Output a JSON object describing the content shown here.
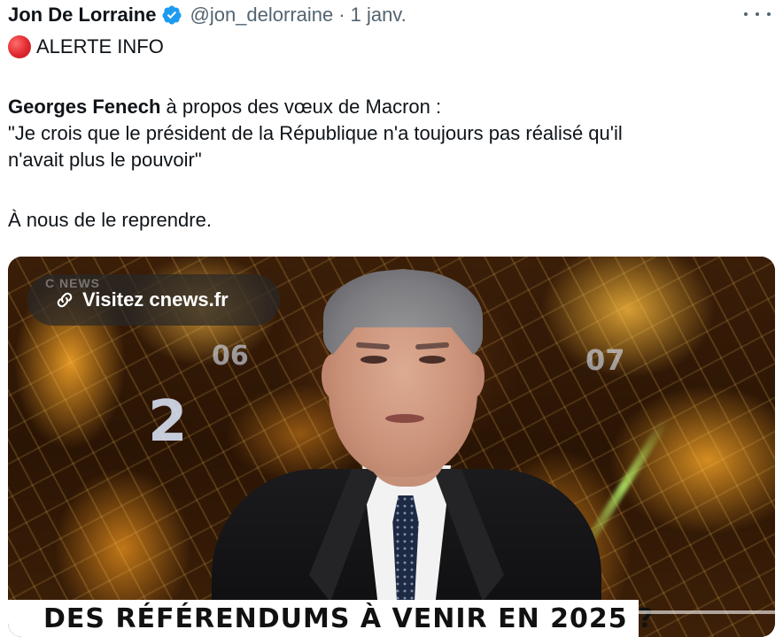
{
  "tweet": {
    "author": {
      "display_name": "Jon De Lorraine",
      "handle": "@jon_delorraine",
      "separator": "·",
      "date": "1 janv.",
      "verified_icon": "verified-badge-icon"
    },
    "more_icon": "more-horizontal-icon",
    "alert_icon": "red-circle-icon",
    "alert_text": "ALERTE INFO",
    "speaker_name": "Georges Fenech",
    "intro_rest": " à propos des vœux de Macron :",
    "quote_line1": "\"Je crois que le président de la République n'a toujours pas réalisé qu'il",
    "quote_line2": "n'avait plus le pouvoir\"",
    "closing": "À nous de le reprendre.",
    "media": {
      "visit_link_icon": "link-icon",
      "visit_link_text": "Visitez cnews.fr",
      "channel_mark": "C NEWS",
      "map_numbers": [
        "2",
        "06",
        "07"
      ],
      "banner_text": "DES RÉFÉRENDUMS À VENIR EN 2025 ?"
    }
  },
  "colors": {
    "text_primary": "#0f1419",
    "text_secondary": "#536471",
    "verified_blue": "#1d9bf0",
    "alert_red": "#e0282e"
  }
}
